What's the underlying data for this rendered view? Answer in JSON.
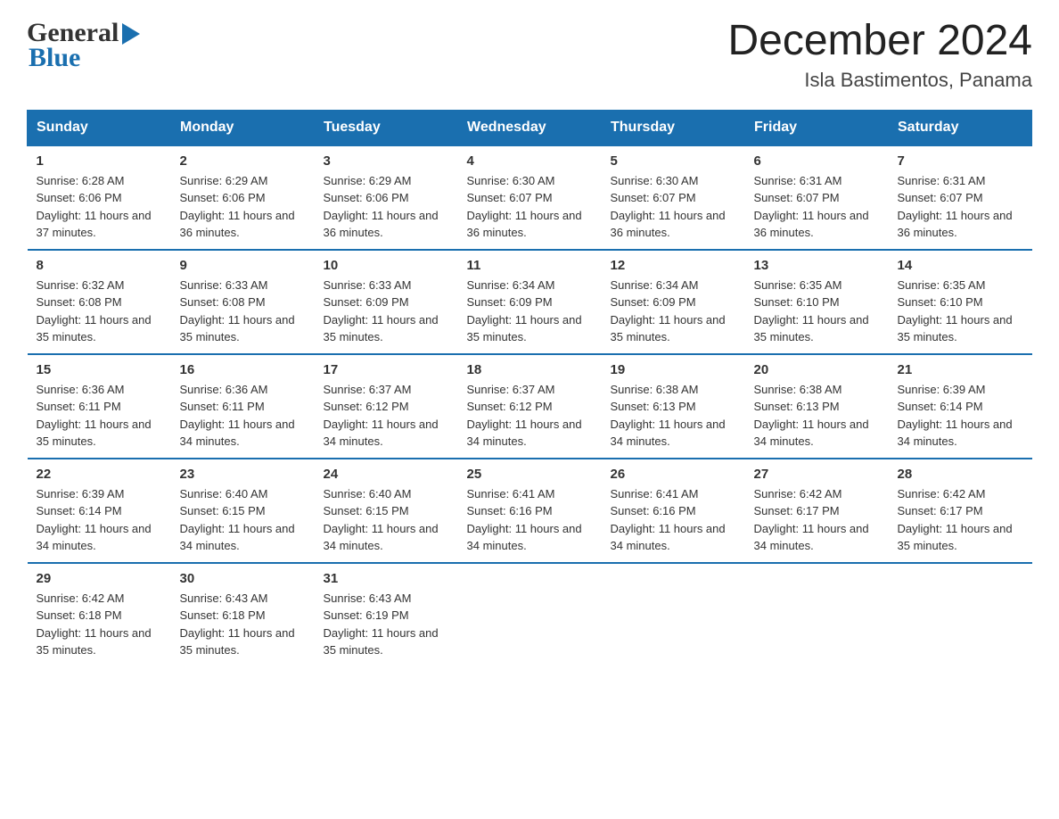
{
  "header": {
    "logo_general": "General",
    "logo_blue": "Blue",
    "month_title": "December 2024",
    "subtitle": "Isla Bastimentos, Panama"
  },
  "days_of_week": [
    "Sunday",
    "Monday",
    "Tuesday",
    "Wednesday",
    "Thursday",
    "Friday",
    "Saturday"
  ],
  "weeks": [
    [
      {
        "day": 1,
        "sunrise": "6:28 AM",
        "sunset": "6:06 PM",
        "daylight": "11 hours and 37 minutes."
      },
      {
        "day": 2,
        "sunrise": "6:29 AM",
        "sunset": "6:06 PM",
        "daylight": "11 hours and 36 minutes."
      },
      {
        "day": 3,
        "sunrise": "6:29 AM",
        "sunset": "6:06 PM",
        "daylight": "11 hours and 36 minutes."
      },
      {
        "day": 4,
        "sunrise": "6:30 AM",
        "sunset": "6:07 PM",
        "daylight": "11 hours and 36 minutes."
      },
      {
        "day": 5,
        "sunrise": "6:30 AM",
        "sunset": "6:07 PM",
        "daylight": "11 hours and 36 minutes."
      },
      {
        "day": 6,
        "sunrise": "6:31 AM",
        "sunset": "6:07 PM",
        "daylight": "11 hours and 36 minutes."
      },
      {
        "day": 7,
        "sunrise": "6:31 AM",
        "sunset": "6:07 PM",
        "daylight": "11 hours and 36 minutes."
      }
    ],
    [
      {
        "day": 8,
        "sunrise": "6:32 AM",
        "sunset": "6:08 PM",
        "daylight": "11 hours and 35 minutes."
      },
      {
        "day": 9,
        "sunrise": "6:33 AM",
        "sunset": "6:08 PM",
        "daylight": "11 hours and 35 minutes."
      },
      {
        "day": 10,
        "sunrise": "6:33 AM",
        "sunset": "6:09 PM",
        "daylight": "11 hours and 35 minutes."
      },
      {
        "day": 11,
        "sunrise": "6:34 AM",
        "sunset": "6:09 PM",
        "daylight": "11 hours and 35 minutes."
      },
      {
        "day": 12,
        "sunrise": "6:34 AM",
        "sunset": "6:09 PM",
        "daylight": "11 hours and 35 minutes."
      },
      {
        "day": 13,
        "sunrise": "6:35 AM",
        "sunset": "6:10 PM",
        "daylight": "11 hours and 35 minutes."
      },
      {
        "day": 14,
        "sunrise": "6:35 AM",
        "sunset": "6:10 PM",
        "daylight": "11 hours and 35 minutes."
      }
    ],
    [
      {
        "day": 15,
        "sunrise": "6:36 AM",
        "sunset": "6:11 PM",
        "daylight": "11 hours and 35 minutes."
      },
      {
        "day": 16,
        "sunrise": "6:36 AM",
        "sunset": "6:11 PM",
        "daylight": "11 hours and 34 minutes."
      },
      {
        "day": 17,
        "sunrise": "6:37 AM",
        "sunset": "6:12 PM",
        "daylight": "11 hours and 34 minutes."
      },
      {
        "day": 18,
        "sunrise": "6:37 AM",
        "sunset": "6:12 PM",
        "daylight": "11 hours and 34 minutes."
      },
      {
        "day": 19,
        "sunrise": "6:38 AM",
        "sunset": "6:13 PM",
        "daylight": "11 hours and 34 minutes."
      },
      {
        "day": 20,
        "sunrise": "6:38 AM",
        "sunset": "6:13 PM",
        "daylight": "11 hours and 34 minutes."
      },
      {
        "day": 21,
        "sunrise": "6:39 AM",
        "sunset": "6:14 PM",
        "daylight": "11 hours and 34 minutes."
      }
    ],
    [
      {
        "day": 22,
        "sunrise": "6:39 AM",
        "sunset": "6:14 PM",
        "daylight": "11 hours and 34 minutes."
      },
      {
        "day": 23,
        "sunrise": "6:40 AM",
        "sunset": "6:15 PM",
        "daylight": "11 hours and 34 minutes."
      },
      {
        "day": 24,
        "sunrise": "6:40 AM",
        "sunset": "6:15 PM",
        "daylight": "11 hours and 34 minutes."
      },
      {
        "day": 25,
        "sunrise": "6:41 AM",
        "sunset": "6:16 PM",
        "daylight": "11 hours and 34 minutes."
      },
      {
        "day": 26,
        "sunrise": "6:41 AM",
        "sunset": "6:16 PM",
        "daylight": "11 hours and 34 minutes."
      },
      {
        "day": 27,
        "sunrise": "6:42 AM",
        "sunset": "6:17 PM",
        "daylight": "11 hours and 34 minutes."
      },
      {
        "day": 28,
        "sunrise": "6:42 AM",
        "sunset": "6:17 PM",
        "daylight": "11 hours and 35 minutes."
      }
    ],
    [
      {
        "day": 29,
        "sunrise": "6:42 AM",
        "sunset": "6:18 PM",
        "daylight": "11 hours and 35 minutes."
      },
      {
        "day": 30,
        "sunrise": "6:43 AM",
        "sunset": "6:18 PM",
        "daylight": "11 hours and 35 minutes."
      },
      {
        "day": 31,
        "sunrise": "6:43 AM",
        "sunset": "6:19 PM",
        "daylight": "11 hours and 35 minutes."
      },
      null,
      null,
      null,
      null
    ]
  ],
  "labels": {
    "sunrise_prefix": "Sunrise: ",
    "sunset_prefix": "Sunset: ",
    "daylight_prefix": "Daylight: "
  },
  "colors": {
    "header_bg": "#1a6faf",
    "border": "#1a6faf",
    "logo_dark": "#333333",
    "logo_blue": "#1a6faf"
  }
}
